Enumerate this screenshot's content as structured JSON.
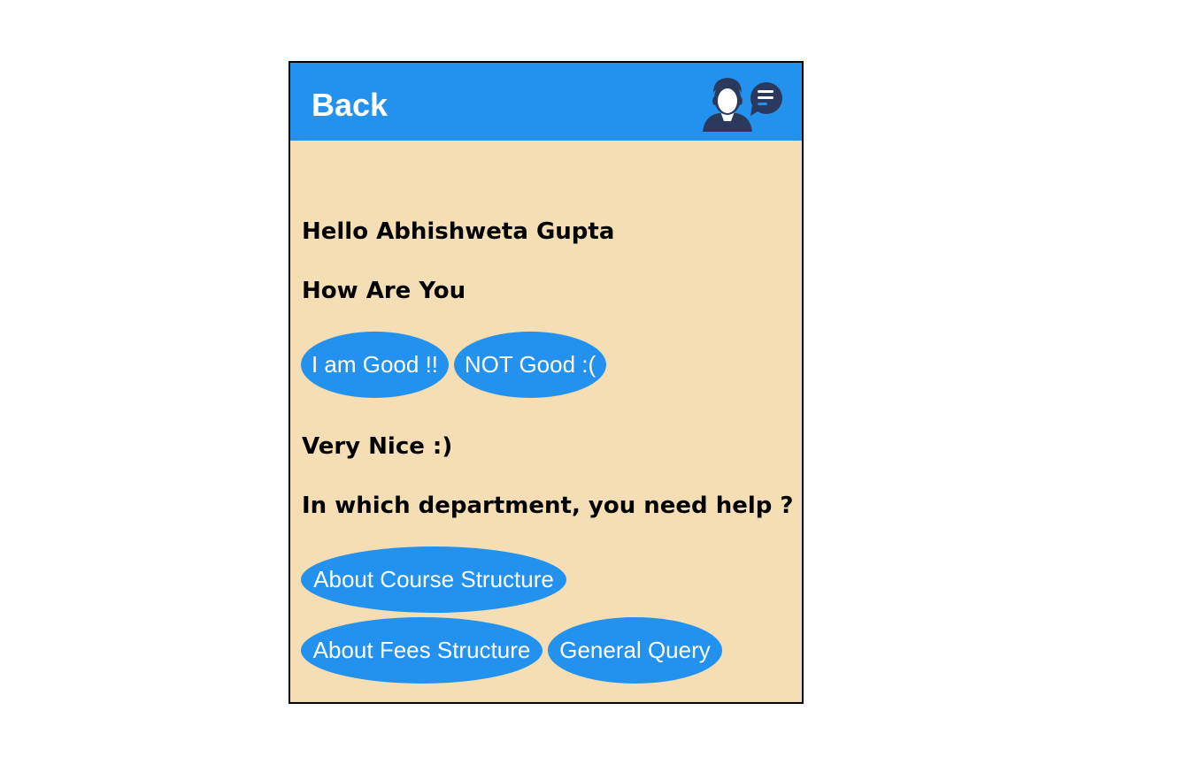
{
  "header": {
    "back_label": "Back",
    "logo_icon": "chatbot-agent-icon"
  },
  "colors": {
    "header": "#2391ee",
    "body": "#f5deb3",
    "option": "#2391ee",
    "avatar": "#2b3a5c"
  },
  "chat": {
    "greeting": "Hello Abhishweta Gupta",
    "question1": "How Are You",
    "options1": [
      "I am Good !!",
      "NOT Good :("
    ],
    "reply": "Very Nice :)",
    "question2": "In which department, you need help ?",
    "options2": [
      "About Course Structure",
      "About Fees Structure",
      "General Query"
    ]
  }
}
